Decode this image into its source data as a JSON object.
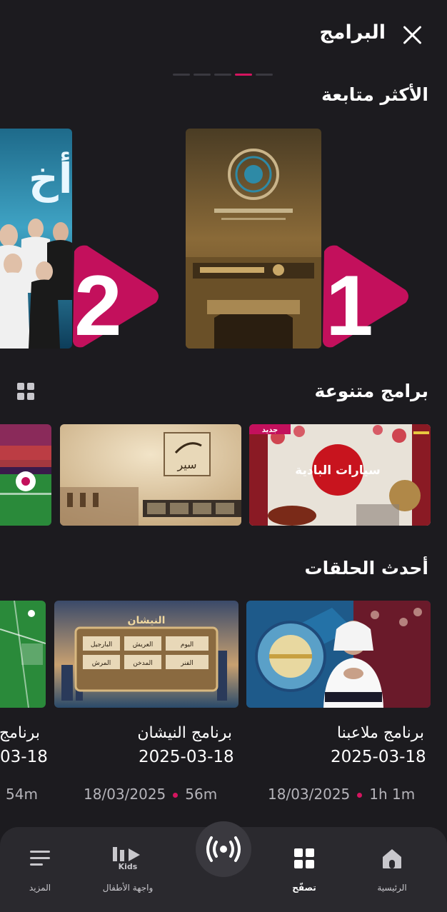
{
  "header": {
    "title": "البرامج"
  },
  "carousel": {
    "dots": 5,
    "active_index": 3
  },
  "most_watched": {
    "title": "الأكثر متابعة",
    "items": [
      {
        "rank": "1"
      },
      {
        "rank": "2"
      }
    ]
  },
  "various": {
    "title": "برامج متنوعة",
    "new_badge": "جديد",
    "card_text": "سيارات البادية"
  },
  "latest": {
    "title": "أحدث الحلقات",
    "episodes": [
      {
        "title": "برنامج ملاعبنا",
        "date": "2025-03-18",
        "aired": "18/03/2025",
        "duration": "1h 1m"
      },
      {
        "title": "برنامج النيشان",
        "date": "2025-03-18",
        "aired": "18/03/2025",
        "duration": "56m"
      },
      {
        "title": "برنامج",
        "date": "03-18",
        "aired": "",
        "duration": "54m"
      }
    ],
    "nishan_labels": [
      "اليوم",
      "العريش",
      "البارجيل",
      "الفنر",
      "المدخن",
      "المرش"
    ]
  },
  "nav": {
    "home": "الرئيسية",
    "browse": "تصفّح",
    "kids": "واجهة الأطفال",
    "more": "المزيد",
    "kids_logo": "Kids"
  },
  "colors": {
    "accent": "#d4155f",
    "background": "#1c1b1f",
    "nav_bg": "#2a292e"
  }
}
